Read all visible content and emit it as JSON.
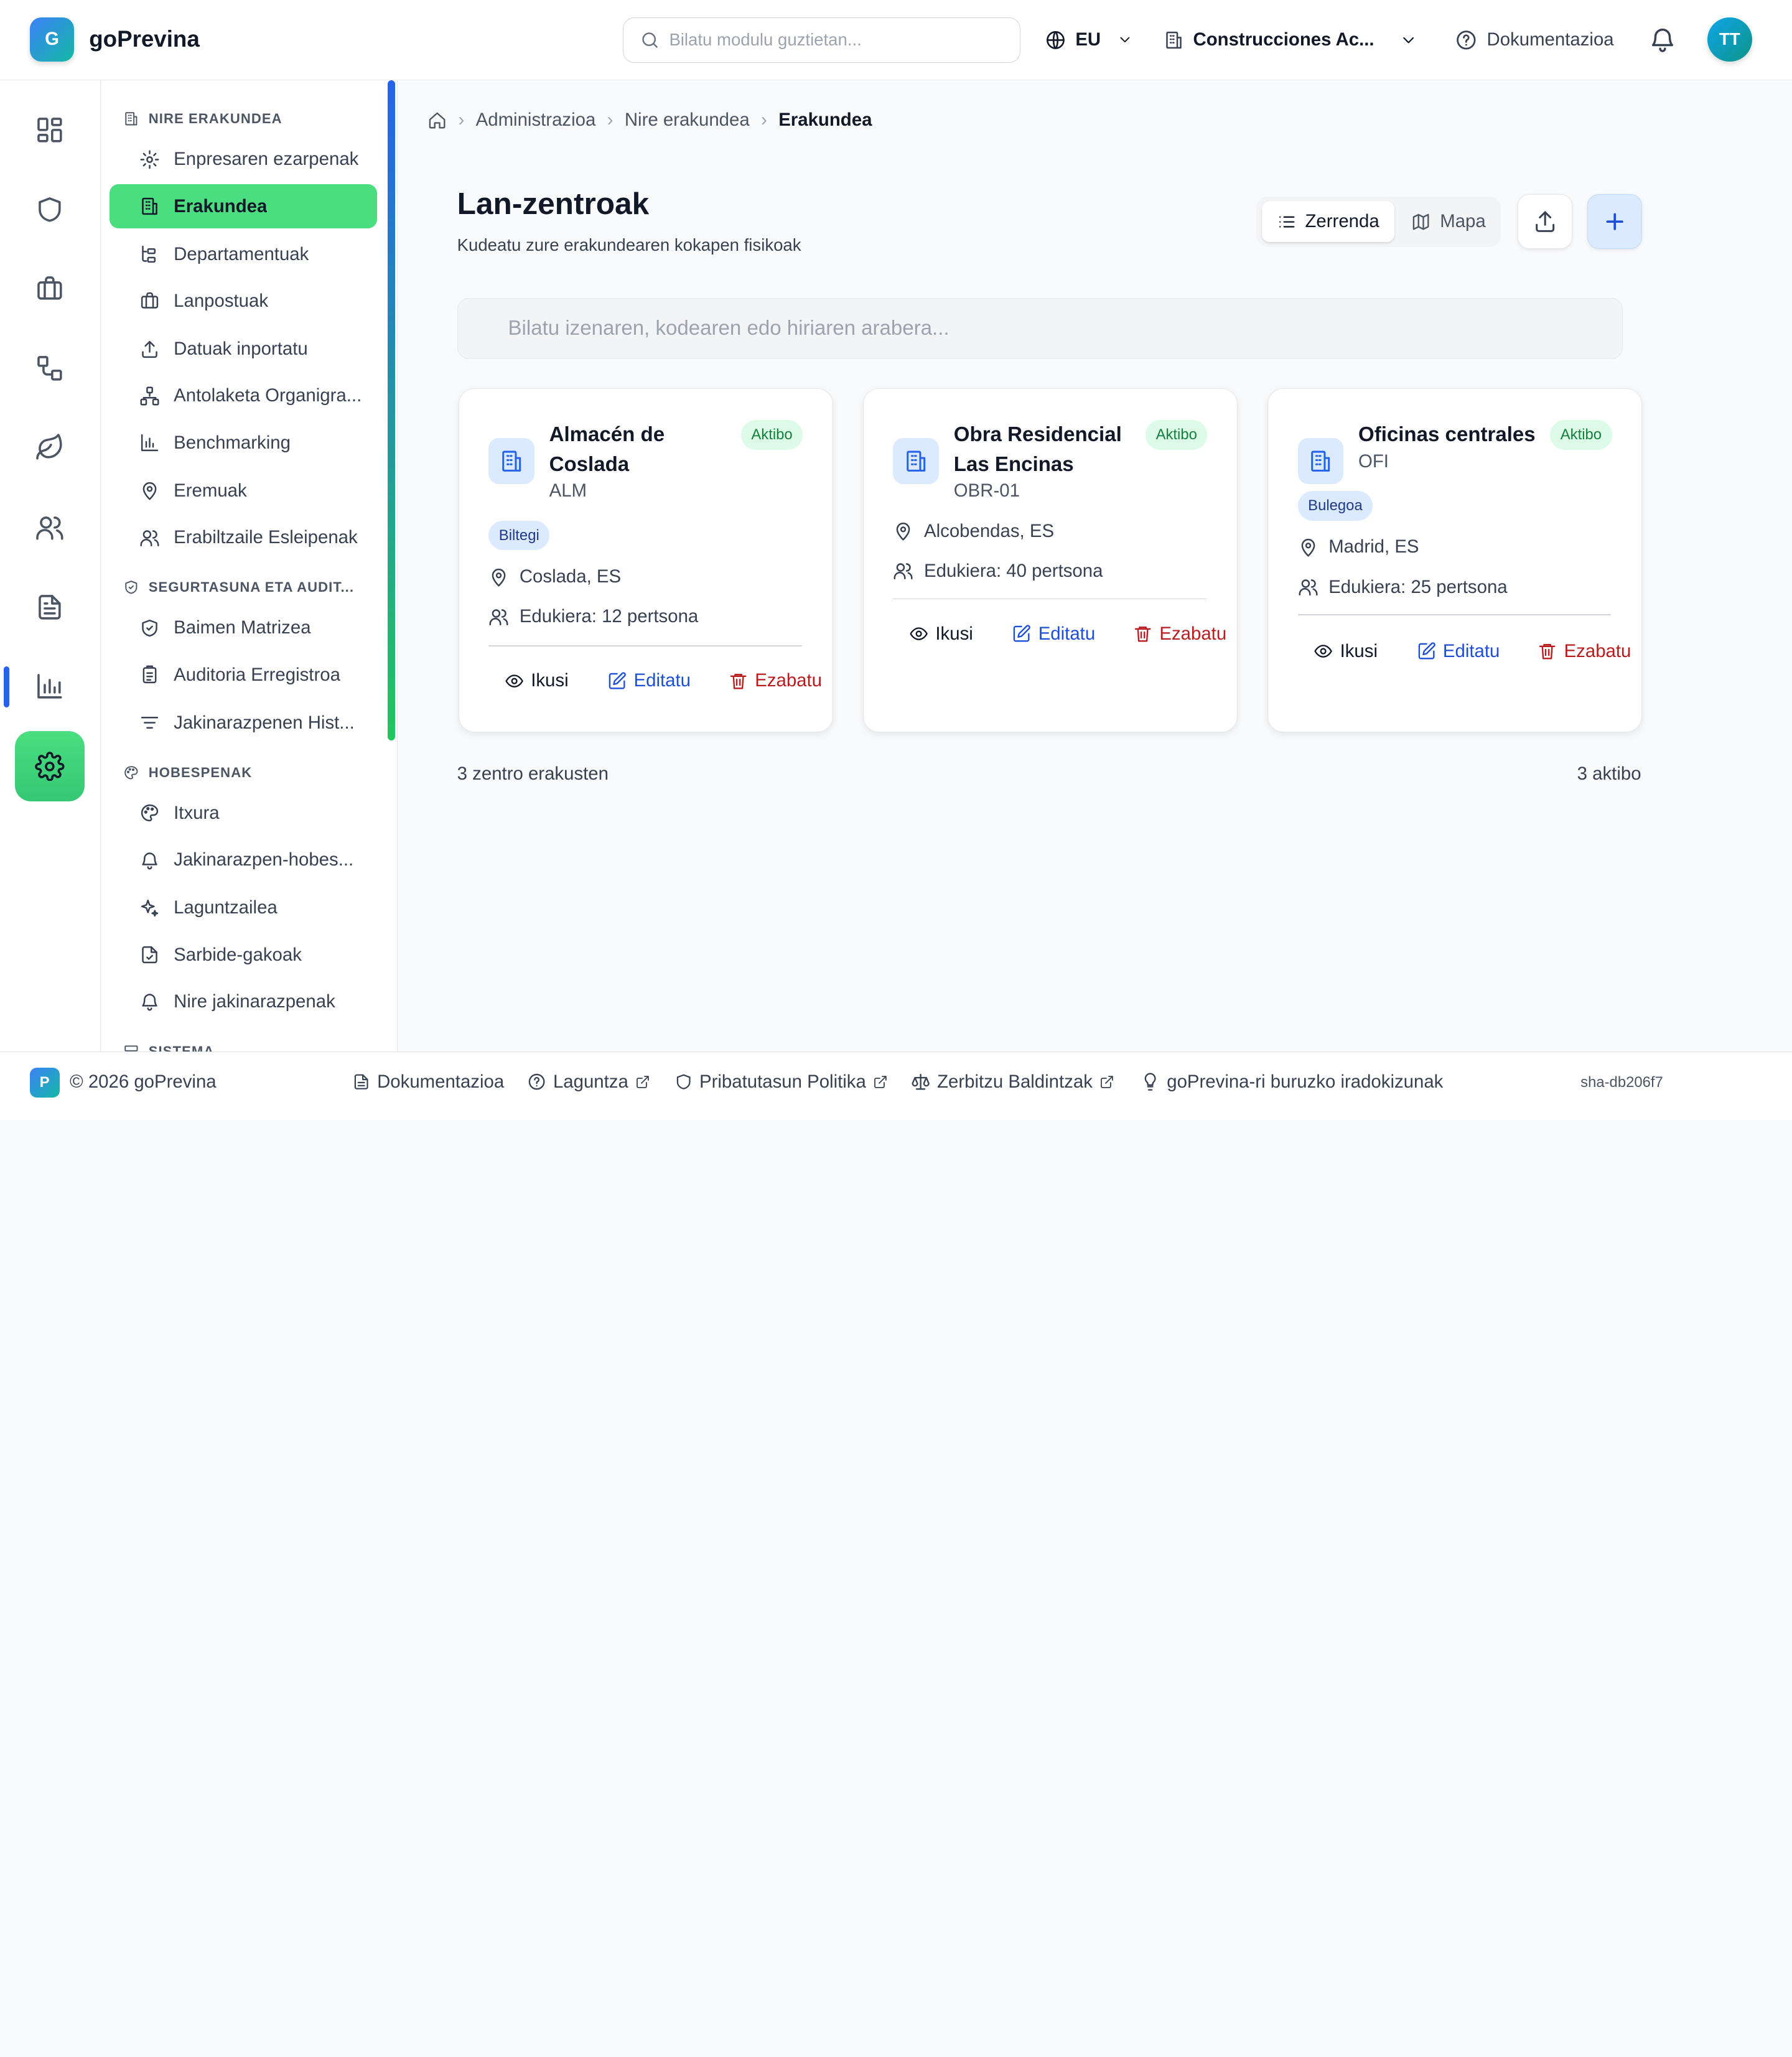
{
  "app": {
    "logo_letter": "G",
    "name": "goPrevina"
  },
  "header": {
    "search_placeholder": "Bilatu modulu guztietan...",
    "language": "EU",
    "organization": "Construcciones Ac...",
    "docs_label": "Dokumentazioa",
    "avatar_initials": "TT"
  },
  "rail": {
    "items": [
      "dashboard-icon",
      "shield-icon",
      "briefcase-icon",
      "workflow-icon",
      "leaf-icon",
      "users-icon",
      "document-icon",
      "chart-icon",
      "settings-icon"
    ],
    "active": "settings-icon"
  },
  "sidebar": {
    "sections": [
      {
        "title": "NIRE ERAKUNDEA",
        "items": [
          "Enpresaren ezarpenak",
          "Erakundea",
          "Departamentuak",
          "Lanpostuak",
          "Datuak inportatu",
          "Antolaketa Organigra...",
          "Benchmarking",
          "Eremuak",
          "Erabiltzaile Esleipenak"
        ]
      },
      {
        "title": "SEGURTASUNA ETA AUDIT...",
        "items": [
          "Baimen Matrizea",
          "Auditoria Erregistroa",
          "Jakinarazpenen Hist..."
        ]
      },
      {
        "title": "HOBESPENAK",
        "items": [
          "Itxura",
          "Jakinarazpen-hobes...",
          "Laguntzailea",
          "Sarbide-gakoak",
          "Nire jakinarazpenak"
        ]
      },
      {
        "title": "SISTEMA",
        "items": []
      }
    ],
    "active_item": "Erakundea"
  },
  "breadcrumb": [
    "Administrazioa",
    "Nire erakundea",
    "Erakundea"
  ],
  "page": {
    "title": "Lan-zentroak",
    "subtitle": "Kudeatu zure erakundearen kokapen fisikoak",
    "view_list": "Zerrenda",
    "view_map": "Mapa",
    "filter_placeholder": "Bilatu izenaren, kodearen edo hiriaren arabera..."
  },
  "centers": [
    {
      "name": "Almacén de Coslada",
      "code": "ALM",
      "status": "Aktibo",
      "type": "Biltegi",
      "location": "Coslada, ES",
      "capacity": "Edukiera: 12 pertsona"
    },
    {
      "name": "Obra Residencial Las Encinas",
      "code": "OBR-01",
      "status": "Aktibo",
      "type": "",
      "location": "Alcobendas, ES",
      "capacity": "Edukiera: 40 pertsona"
    },
    {
      "name": "Oficinas centrales",
      "code": "OFI",
      "status": "Aktibo",
      "type": "Bulegoa",
      "location": "Madrid, ES",
      "capacity": "Edukiera: 25 pertsona"
    }
  ],
  "actions": {
    "view": "Ikusi",
    "edit": "Editatu",
    "delete": "Ezabatu"
  },
  "summary": {
    "showing": "3 zentro erakusten",
    "active": "3 aktibo"
  },
  "footer": {
    "logo_letter": "P",
    "copyright": "© 2026 goPrevina",
    "links": [
      "Dokumentazioa",
      "Laguntza",
      "Pribatutasun Politika",
      "Zerbitzu Baldintzak",
      "goPrevina-ri buruzko iradokizunak"
    ],
    "sha": "sha-db206f7"
  },
  "colors": {
    "accent_green": "#4ade80",
    "primary_blue": "#2563eb",
    "danger_red": "#b91c1c"
  }
}
